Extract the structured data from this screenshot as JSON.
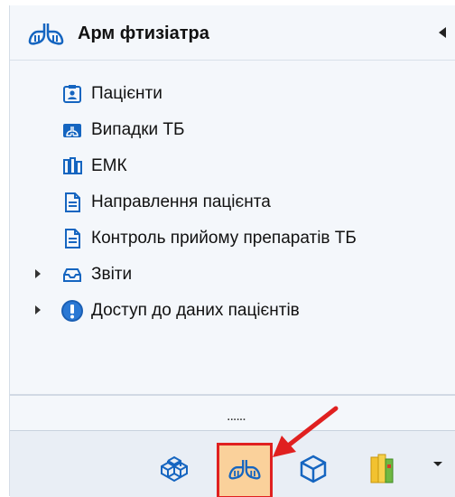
{
  "header": {
    "title": "Арм фтизіатра"
  },
  "tree": {
    "items": [
      {
        "label": "Пацієнти",
        "icon": "patient-card-icon"
      },
      {
        "label": "Випадки ТБ",
        "icon": "tb-cases-icon"
      },
      {
        "label": "ЕМК",
        "icon": "emr-icon"
      },
      {
        "label": "Направлення пацієнта",
        "icon": "document-icon"
      },
      {
        "label": "Контроль прийому препаратів ТБ",
        "icon": "document-icon"
      },
      {
        "label": "Звіти",
        "icon": "reports-tray-icon"
      },
      {
        "label": "Доступ до даних пацієнтів",
        "icon": "info-icon"
      }
    ]
  },
  "grip": "......",
  "colors": {
    "accent": "#1565c0",
    "selected_bg": "#fad19b",
    "highlight": "#e02020"
  }
}
